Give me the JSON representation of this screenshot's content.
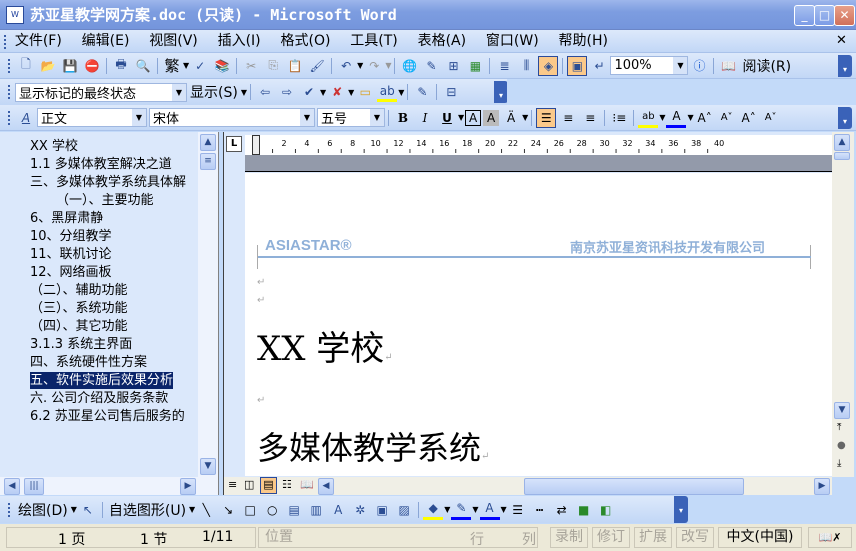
{
  "window": {
    "title": "苏亚星教学网方案.doc (只读) - Microsoft Word",
    "app_icon": "W"
  },
  "menu": [
    "文件(F)",
    "编辑(E)",
    "视图(V)",
    "插入(I)",
    "格式(O)",
    "工具(T)",
    "表格(A)",
    "窗口(W)",
    "帮助(H)"
  ],
  "standard": {
    "trad_label": "繁",
    "zoom": "100%",
    "read_label": "阅读(R)"
  },
  "reviewing": {
    "display_for_review": "显示标记的最终状态",
    "show_label": "显示(S)"
  },
  "formatting": {
    "style": "正文",
    "font": "宋体",
    "size": "五号",
    "align": "justify"
  },
  "docmap": {
    "items": [
      "XX 学校",
      "1.1  多媒体教室解决之道",
      "三、多媒体教学系统具体解",
      "（一）、主要功能",
      "6、黑屏肃静",
      "10、分组教学",
      "11、联机讨论",
      "12、网络画板",
      "（二）、辅助功能",
      "（三）、系统功能",
      "（四）、其它功能",
      "3.1.3 系统主界面",
      "四、系统硬件性方案",
      "五、软件实施后效果分析",
      "六. 公司介绍及服务条款",
      "6.2  苏亚星公司售后服务的"
    ],
    "selected_index": 13
  },
  "ruler": {
    "ticks": [
      "2",
      "4",
      "6",
      "8",
      "10",
      "12",
      "14",
      "16",
      "18",
      "20",
      "22",
      "24",
      "26",
      "28",
      "30",
      "32",
      "34",
      "36",
      "38",
      "40"
    ],
    "tab_button": "L"
  },
  "document": {
    "header_logo": "ASIASTAR®",
    "header_company": "南京苏亚星资讯科技开发有限公司",
    "heading1": "XX 学校",
    "heading2": "多媒体教学系统",
    "para_mark": "↵"
  },
  "drawing": {
    "draw_label": "绘图(D)",
    "autoshapes_label": "自选图形(U)"
  },
  "status": {
    "page": "1 页",
    "section": "1 节",
    "pages": "1/11",
    "position": "位置",
    "line": "行",
    "col": "列",
    "rec": "录制",
    "trk": "修订",
    "ext": "扩展",
    "ovr": "改写",
    "lang": "中文(中国)"
  },
  "colors": {
    "highlight": "#ffff00",
    "font_color": "#0000ff",
    "selection": "#0a246a",
    "logo": "#8fb0d8"
  }
}
